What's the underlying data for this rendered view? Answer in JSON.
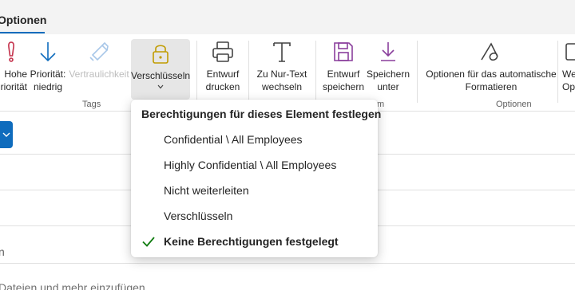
{
  "tabs": {
    "active": "Optionen"
  },
  "ribbon": {
    "buttons": {
      "high_priority": "Hohe\nPriorität",
      "low_priority": "Priorität:\nniedrig",
      "sensitivity": "Vertraulichkeit",
      "encrypt": "Verschlüsseln",
      "draft_print": "Entwurf\ndrucken",
      "plain_text": "Zu Nur-Text\nwechseln",
      "save_draft": "Entwurf\nspeichern",
      "save_as": "Speichern\nunter",
      "autoformat": "Optionen für das automatische\nFormatieren",
      "more": "We\nOp"
    },
    "groups": {
      "tags": "Tags",
      "options": "Optionen",
      "cut": "m"
    }
  },
  "compose": {
    "send_icon": "chevron-down-icon",
    "body_hint": "Dateien und mehr einzufügen",
    "subject_fragment": "n"
  },
  "menu": {
    "title": "Berechtigungen für dieses Element festlegen",
    "items": [
      {
        "label": "Confidential \\ All Employees",
        "checked": false
      },
      {
        "label": "Highly Confidential \\ All Employees",
        "checked": false
      },
      {
        "label": "Nicht weiterleiten",
        "checked": false
      },
      {
        "label": "Verschlüsseln",
        "checked": false
      },
      {
        "label": "Keine Berechtigungen festgelegt",
        "checked": true
      }
    ]
  },
  "colors": {
    "accent": "#0f6cbd",
    "priority_high": "#c4314b",
    "save": "#8a3f9c",
    "check": "#107c10"
  }
}
